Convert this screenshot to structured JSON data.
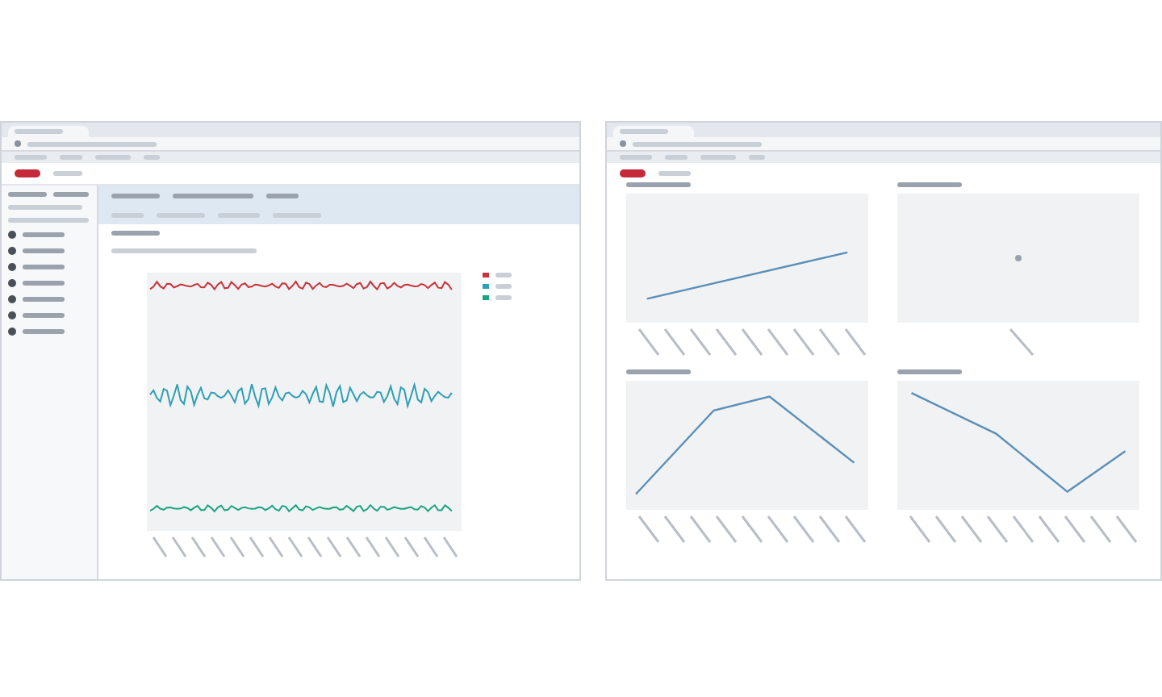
{
  "left_window": {
    "trend_series": [
      {
        "color": "#c8343c"
      },
      {
        "color": "#2f9fb5"
      },
      {
        "color": "#1aa57f"
      }
    ]
  },
  "right_window": {
    "charts": [
      {
        "kind": "line"
      },
      {
        "kind": "point"
      },
      {
        "kind": "line"
      },
      {
        "kind": "line"
      }
    ]
  }
}
